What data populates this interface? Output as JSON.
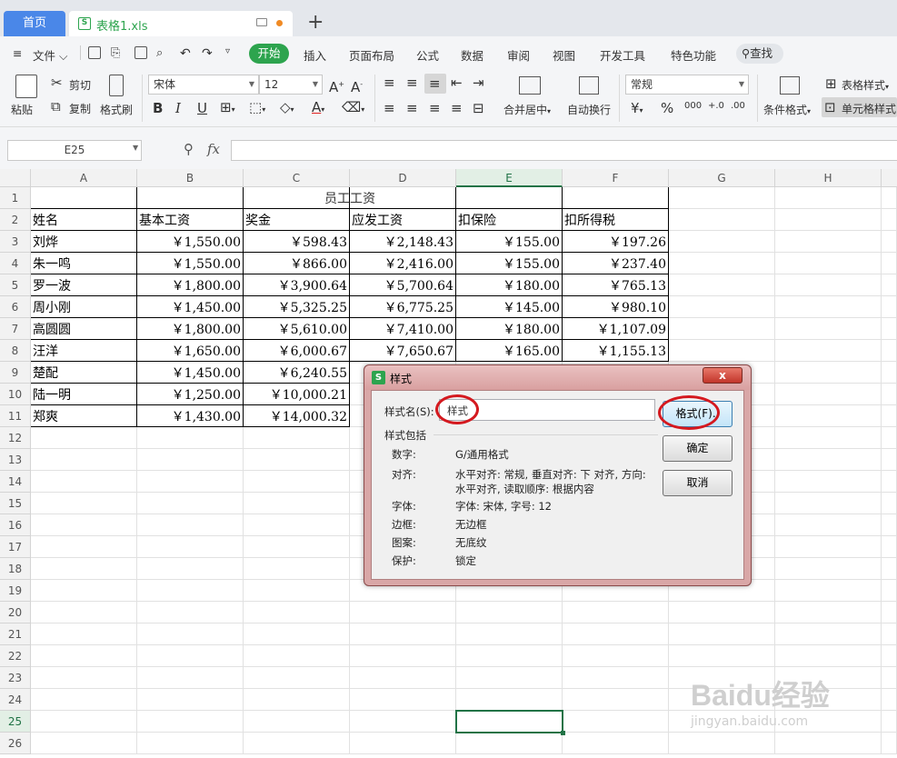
{
  "tabbar": {
    "home": "首页",
    "file_name": "表格1.xls",
    "new_tab": "+"
  },
  "menubar": {
    "file": "文件",
    "active": "开始",
    "items": [
      "插入",
      "页面布局",
      "公式",
      "数据",
      "审阅",
      "视图",
      "开发工具",
      "特色功能"
    ],
    "find": "查找"
  },
  "ribbon": {
    "paste": "粘贴",
    "cut": "剪切",
    "copy": "复制",
    "format_painter": "格式刷",
    "font": "宋体",
    "font_size": "12",
    "merge_center": "合并居中",
    "wrap_text": "自动换行",
    "number_format": "常规",
    "conditional_format": "条件格式",
    "table_style": "表格样式",
    "cell_style": "单元格样式"
  },
  "formula_bar": {
    "name_box": "E25",
    "fx": "fx",
    "content": ""
  },
  "sheet": {
    "columns": [
      "A",
      "B",
      "C",
      "D",
      "E",
      "F",
      "G",
      "H"
    ],
    "rows": [
      "1",
      "2",
      "3",
      "4",
      "5",
      "6",
      "7",
      "8",
      "9",
      "10",
      "11",
      "12",
      "13",
      "14",
      "15",
      "16",
      "17",
      "18",
      "19",
      "20",
      "21",
      "22",
      "23",
      "24",
      "25",
      "26"
    ],
    "title": "员工工资",
    "headers": [
      "姓名",
      "基本工资",
      "奖金",
      "应发工资",
      "扣保险",
      "扣所得税"
    ],
    "data": [
      [
        "刘烨",
        "￥1,550.00",
        "￥598.43",
        "￥2,148.43",
        "￥155.00",
        "￥197.26"
      ],
      [
        "朱一鸣",
        "￥1,550.00",
        "￥866.00",
        "￥2,416.00",
        "￥155.00",
        "￥237.40"
      ],
      [
        "罗一波",
        "￥1,800.00",
        "￥3,900.64",
        "￥5,700.64",
        "￥180.00",
        "￥765.13"
      ],
      [
        "周小刚",
        "￥1,450.00",
        "￥5,325.25",
        "￥6,775.25",
        "￥145.00",
        "￥980.10"
      ],
      [
        "高圆圆",
        "￥1,800.00",
        "￥5,610.00",
        "￥7,410.00",
        "￥180.00",
        "￥1,107.09"
      ],
      [
        "汪洋",
        "￥1,650.00",
        "￥6,000.67",
        "￥7,650.67",
        "￥165.00",
        "￥1,155.13"
      ],
      [
        "楚配",
        "￥1,450.00",
        "￥6,240.55",
        "",
        "",
        ""
      ],
      [
        "陆一明",
        "￥1,250.00",
        "￥10,000.21",
        "",
        "",
        ""
      ],
      [
        "郑爽",
        "￥1,430.00",
        "￥14,000.32",
        "",
        "",
        ""
      ]
    ],
    "selected_cell": "E25"
  },
  "dialog": {
    "title": "样式",
    "close": "x",
    "name_label": "样式名(S):",
    "name_value": "样式",
    "includes_label": "样式包括",
    "props": [
      {
        "label": "数字:",
        "value": "G/通用格式"
      },
      {
        "label": "对齐:",
        "value": "水平对齐: 常规, 垂直对齐: 下 对齐, 方向:"
      },
      {
        "label": "",
        "value": "水平对齐, 读取顺序: 根据内容"
      },
      {
        "label": "字体:",
        "value": "字体: 宋体, 字号: 12"
      },
      {
        "label": "边框:",
        "value": "无边框"
      },
      {
        "label": "图案:",
        "value": "无底纹"
      },
      {
        "label": "保护:",
        "value": "锁定"
      }
    ],
    "format_button": "格式(F)..",
    "ok_button": "确定",
    "cancel_button": "取消"
  },
  "watermark": {
    "brand": "Baidu经验",
    "url": "jingyan.baidu.com"
  },
  "colors": {
    "accent_green": "#2da44e",
    "home_blue": "#4a87e8",
    "select_green": "#217346",
    "annotation_red": "#d4191f"
  }
}
